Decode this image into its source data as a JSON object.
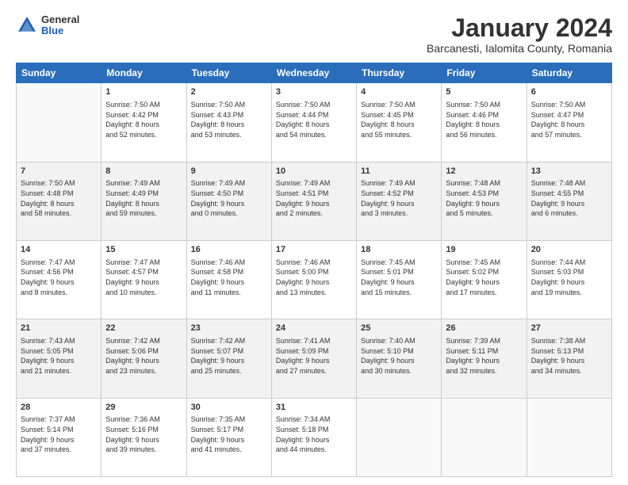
{
  "header": {
    "logo_general": "General",
    "logo_blue": "Blue",
    "title": "January 2024",
    "location": "Barcanesti, Ialomita County, Romania"
  },
  "days_of_week": [
    "Sunday",
    "Monday",
    "Tuesday",
    "Wednesday",
    "Thursday",
    "Friday",
    "Saturday"
  ],
  "weeks": [
    [
      {
        "day": "",
        "info": ""
      },
      {
        "day": "1",
        "info": "Sunrise: 7:50 AM\nSunset: 4:42 PM\nDaylight: 8 hours\nand 52 minutes."
      },
      {
        "day": "2",
        "info": "Sunrise: 7:50 AM\nSunset: 4:43 PM\nDaylight: 8 hours\nand 53 minutes."
      },
      {
        "day": "3",
        "info": "Sunrise: 7:50 AM\nSunset: 4:44 PM\nDaylight: 8 hours\nand 54 minutes."
      },
      {
        "day": "4",
        "info": "Sunrise: 7:50 AM\nSunset: 4:45 PM\nDaylight: 8 hours\nand 55 minutes."
      },
      {
        "day": "5",
        "info": "Sunrise: 7:50 AM\nSunset: 4:46 PM\nDaylight: 8 hours\nand 56 minutes."
      },
      {
        "day": "6",
        "info": "Sunrise: 7:50 AM\nSunset: 4:47 PM\nDaylight: 8 hours\nand 57 minutes."
      }
    ],
    [
      {
        "day": "7",
        "info": "Sunrise: 7:50 AM\nSunset: 4:48 PM\nDaylight: 8 hours\nand 58 minutes."
      },
      {
        "day": "8",
        "info": "Sunrise: 7:49 AM\nSunset: 4:49 PM\nDaylight: 8 hours\nand 59 minutes."
      },
      {
        "day": "9",
        "info": "Sunrise: 7:49 AM\nSunset: 4:50 PM\nDaylight: 9 hours\nand 0 minutes."
      },
      {
        "day": "10",
        "info": "Sunrise: 7:49 AM\nSunset: 4:51 PM\nDaylight: 9 hours\nand 2 minutes."
      },
      {
        "day": "11",
        "info": "Sunrise: 7:49 AM\nSunset: 4:52 PM\nDaylight: 9 hours\nand 3 minutes."
      },
      {
        "day": "12",
        "info": "Sunrise: 7:48 AM\nSunset: 4:53 PM\nDaylight: 9 hours\nand 5 minutes."
      },
      {
        "day": "13",
        "info": "Sunrise: 7:48 AM\nSunset: 4:55 PM\nDaylight: 9 hours\nand 6 minutes."
      }
    ],
    [
      {
        "day": "14",
        "info": "Sunrise: 7:47 AM\nSunset: 4:56 PM\nDaylight: 9 hours\nand 8 minutes."
      },
      {
        "day": "15",
        "info": "Sunrise: 7:47 AM\nSunset: 4:57 PM\nDaylight: 9 hours\nand 10 minutes."
      },
      {
        "day": "16",
        "info": "Sunrise: 7:46 AM\nSunset: 4:58 PM\nDaylight: 9 hours\nand 11 minutes."
      },
      {
        "day": "17",
        "info": "Sunrise: 7:46 AM\nSunset: 5:00 PM\nDaylight: 9 hours\nand 13 minutes."
      },
      {
        "day": "18",
        "info": "Sunrise: 7:45 AM\nSunset: 5:01 PM\nDaylight: 9 hours\nand 15 minutes."
      },
      {
        "day": "19",
        "info": "Sunrise: 7:45 AM\nSunset: 5:02 PM\nDaylight: 9 hours\nand 17 minutes."
      },
      {
        "day": "20",
        "info": "Sunrise: 7:44 AM\nSunset: 5:03 PM\nDaylight: 9 hours\nand 19 minutes."
      }
    ],
    [
      {
        "day": "21",
        "info": "Sunrise: 7:43 AM\nSunset: 5:05 PM\nDaylight: 9 hours\nand 21 minutes."
      },
      {
        "day": "22",
        "info": "Sunrise: 7:42 AM\nSunset: 5:06 PM\nDaylight: 9 hours\nand 23 minutes."
      },
      {
        "day": "23",
        "info": "Sunrise: 7:42 AM\nSunset: 5:07 PM\nDaylight: 9 hours\nand 25 minutes."
      },
      {
        "day": "24",
        "info": "Sunrise: 7:41 AM\nSunset: 5:09 PM\nDaylight: 9 hours\nand 27 minutes."
      },
      {
        "day": "25",
        "info": "Sunrise: 7:40 AM\nSunset: 5:10 PM\nDaylight: 9 hours\nand 30 minutes."
      },
      {
        "day": "26",
        "info": "Sunrise: 7:39 AM\nSunset: 5:11 PM\nDaylight: 9 hours\nand 32 minutes."
      },
      {
        "day": "27",
        "info": "Sunrise: 7:38 AM\nSunset: 5:13 PM\nDaylight: 9 hours\nand 34 minutes."
      }
    ],
    [
      {
        "day": "28",
        "info": "Sunrise: 7:37 AM\nSunset: 5:14 PM\nDaylight: 9 hours\nand 37 minutes."
      },
      {
        "day": "29",
        "info": "Sunrise: 7:36 AM\nSunset: 5:16 PM\nDaylight: 9 hours\nand 39 minutes."
      },
      {
        "day": "30",
        "info": "Sunrise: 7:35 AM\nSunset: 5:17 PM\nDaylight: 9 hours\nand 41 minutes."
      },
      {
        "day": "31",
        "info": "Sunrise: 7:34 AM\nSunset: 5:18 PM\nDaylight: 9 hours\nand 44 minutes."
      },
      {
        "day": "",
        "info": ""
      },
      {
        "day": "",
        "info": ""
      },
      {
        "day": "",
        "info": ""
      }
    ]
  ]
}
